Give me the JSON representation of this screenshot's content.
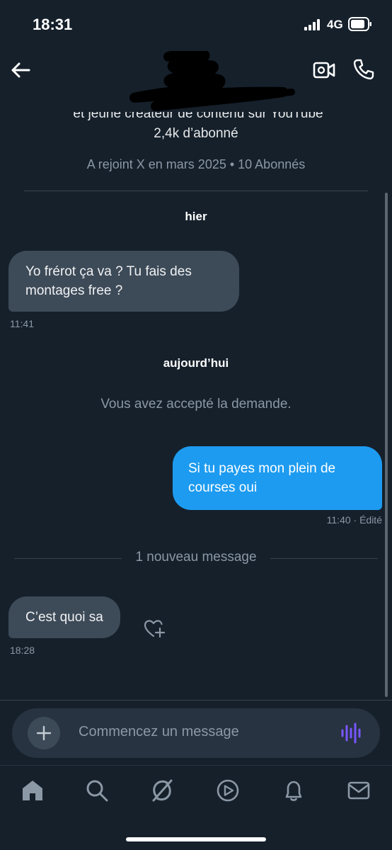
{
  "status": {
    "time": "18:31",
    "network": "4G"
  },
  "profile": {
    "bio_line_clipped": "et jeune créateur de contenu sur YouTube",
    "subscribers": "2,4k d’abonné",
    "joined": "A rejoint X en mars 2025 • 10 Abonnés"
  },
  "conversation": {
    "day1_label": "hier",
    "msg1_text": "Yo frérot ça va ? Tu fais des montages free ?",
    "msg1_time": "11:41",
    "day2_label": "aujourd’hui",
    "system_text": "Vous avez accepté la demande.",
    "msg2_text": "Si tu payes mon plein de courses oui",
    "msg2_time": "11:40 · Édité",
    "new_messages_label": "1 nouveau message",
    "msg3_text": "C’est quoi sa",
    "msg3_time": "18:28"
  },
  "composer": {
    "placeholder": "Commencez un message"
  },
  "colors": {
    "background": "#15202b",
    "incoming_bubble": "#3d4a58",
    "outgoing_bubble": "#1d9bf0",
    "voice_accent": "#7856ff"
  }
}
